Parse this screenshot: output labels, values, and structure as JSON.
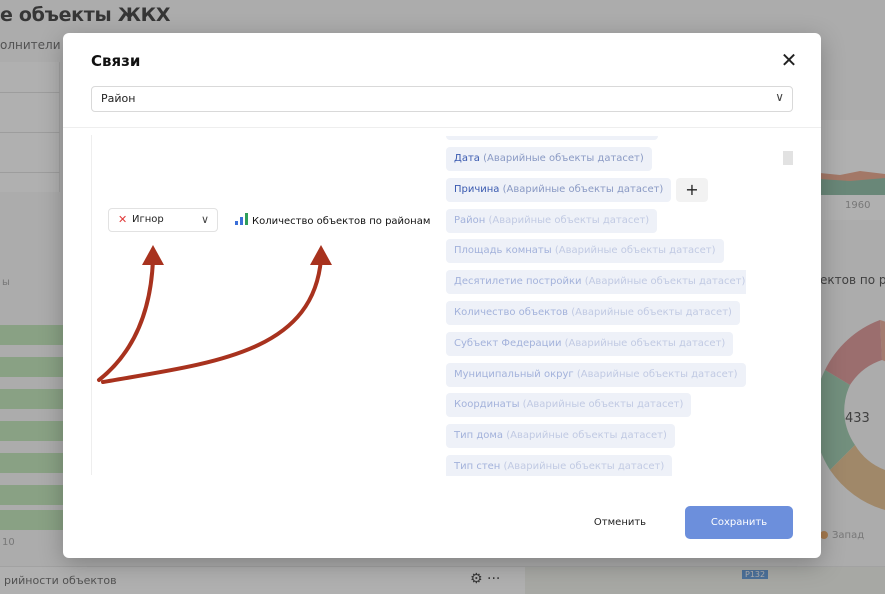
{
  "background": {
    "page_title": "е объекты ЖКХ",
    "subtitle": "олнители",
    "left_axis_labels": [
      "ы",
      "10"
    ],
    "year_tick": "1960",
    "right_widget_title": "ектов по ра",
    "donut_value": "433",
    "legend_item": "Запад",
    "bottom_widget_title": "рийности объектов",
    "bottom_icons": "⚙ ···",
    "map_badge": "Р132"
  },
  "modal": {
    "title": "Связи",
    "close_icon": "✕",
    "selector": {
      "value": "Район",
      "chevron": "∨"
    },
    "link": {
      "type_icon": "✕",
      "type_label": "Игнор",
      "type_chevron": "∨",
      "widget_name": "Количество объектов по районам"
    },
    "fields": [
      {
        "name": "Дата",
        "source": "(Аварийные объекты датасет)",
        "faded": false
      },
      {
        "name": "Причина",
        "source": "(Аварийные объекты датасет)",
        "faded": false
      },
      {
        "name": "Район",
        "source": "(Аварийные объекты датасет)",
        "faded": true
      },
      {
        "name": "Площадь комнаты",
        "source": "(Аварийные объекты датасет)",
        "faded": true
      },
      {
        "name": "Десятилетие постройки",
        "source": "(Аварийные объекты датасет)",
        "faded": true
      },
      {
        "name": "Количество объектов",
        "source": "(Аварийные объекты датасет)",
        "faded": true
      },
      {
        "name": "Субъект Федерации",
        "source": "(Аварийные объекты датасет)",
        "faded": true
      },
      {
        "name": "Муниципальный округ",
        "source": "(Аварийные объекты датасет)",
        "faded": true
      },
      {
        "name": "Координаты",
        "source": "(Аварийные объекты датасет)",
        "faded": true
      },
      {
        "name": "Тип дома",
        "source": "(Аварийные объекты датасет)",
        "faded": true
      },
      {
        "name": "Тип стен",
        "source": "(Аварийные объекты датасет)",
        "faded": true
      }
    ],
    "add_button": "+",
    "cancel_label": "Отменить",
    "save_label": "Сохранить"
  },
  "colors": {
    "accent": "#6c8fdc",
    "field_bg": "#eef1f8",
    "field_text": "#3a5ab0",
    "annotation_arrow": "#a8321e",
    "ignore_x": "#e03a3a",
    "bars_icon": "#3b6fd8"
  }
}
